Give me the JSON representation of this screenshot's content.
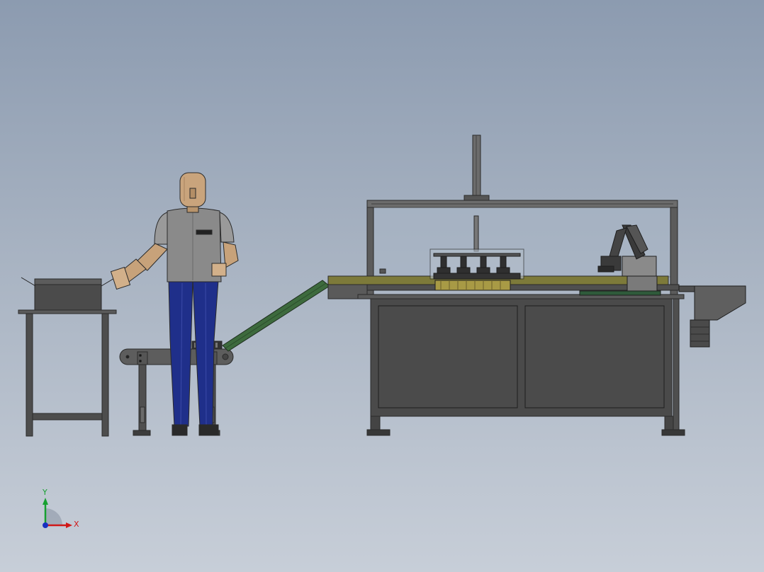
{
  "app": {
    "view": "front",
    "background_top": "#8c9bb0",
    "background_bottom": "#c7ced8"
  },
  "model": {
    "components": [
      "operator-figure",
      "side-table",
      "small-belt-conveyor",
      "inclined-conveyor",
      "machine-frame",
      "capping-head",
      "robot-arm",
      "discharge-chute",
      "drive-motor"
    ]
  },
  "triad": {
    "x_label": "X",
    "y_label": "Y",
    "x_color": "#d01818",
    "y_color": "#16a030",
    "z_color": "#1830c0"
  }
}
